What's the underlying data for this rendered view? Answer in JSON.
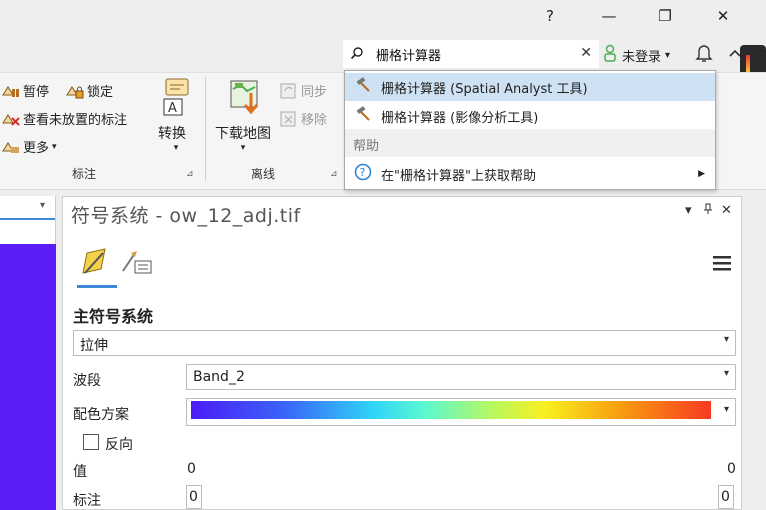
{
  "window": {
    "help_label": "?",
    "minimize_label": "—",
    "restore_label": "❐",
    "close_label": "✕"
  },
  "search": {
    "value": "栅格计算器",
    "clear_label": "✕"
  },
  "user": {
    "label": "未登录",
    "caret": "▾",
    "bell": "🔔",
    "chevron": "︿"
  },
  "ribbon": {
    "pause": "暂停",
    "lock": "锁定",
    "unplaced": "查看未放置的标注",
    "more": "更多",
    "convert": "转换",
    "download_map": "下载地图",
    "sync": "同步",
    "remove": "移除",
    "group_labeling": "标注",
    "group_offline": "离线"
  },
  "dropdown": {
    "items": [
      "栅格计算器 (Spatial Analyst 工具)",
      "栅格计算器 (影像分析工具)"
    ],
    "help_header": "帮助",
    "help_item": "在\"栅格计算器\"上获取帮助"
  },
  "panel": {
    "title": "符号系统 - ow_12_adj.tif",
    "heading": "主符号系统",
    "renderer": "拉伸",
    "band_label": "波段",
    "band_value": "Band_2",
    "ramp_label": "配色方案",
    "invert_label": "反向",
    "value_label": "值",
    "value_min": "0",
    "value_max": "0",
    "label_label": "标注",
    "label_min": "0",
    "label_max": "0"
  },
  "colors": {
    "accent": "#3c8ad6",
    "left_fill": "#5a1ef5",
    "highlight": "#cfe2f3"
  }
}
